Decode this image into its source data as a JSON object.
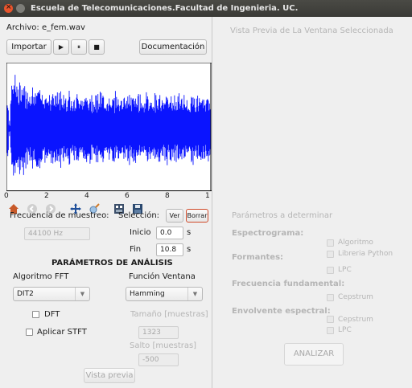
{
  "window": {
    "title": "Escuela de Telecomunicaciones.Facultad de Ingenieria. UC."
  },
  "file": {
    "label": "Archivo:",
    "name": "e_fem.wav"
  },
  "toolbar": {
    "import_label": "Importar",
    "play_icon": "▶",
    "pause_icon": "⏸",
    "stop_icon": "■",
    "docs_label": "Documentación"
  },
  "waveform": {
    "x_ticks": [
      "0",
      "2",
      "4",
      "6",
      "8",
      "1"
    ],
    "color": "#0a14ff"
  },
  "sample_rate": {
    "label": "Frecuencia de muestreo:",
    "placeholder": "44100 Hz"
  },
  "selection": {
    "label": "Selección:",
    "view_label": "Ver",
    "clear_label": "Borrar",
    "start_label": "Inicio",
    "start_value": "0.0",
    "end_label": "Fin",
    "end_value": "10.8",
    "unit": "s"
  },
  "analysis": {
    "heading": "PARÁMETROS DE ANÁLISIS",
    "fft_label": "Algoritmo FFT",
    "fft_value": "DIT2",
    "window_label": "Función Ventana",
    "window_value": "Hamming",
    "dft_label": "DFT",
    "stft_label": "Aplicar STFT",
    "size_label": "Tamaño [muestras]",
    "size_value": "1323",
    "hop_label": "Salto [muestras]",
    "hop_value": "-500",
    "preview_label": "Vista previa"
  },
  "preview": {
    "header": "Vista Previa de La Ventana Seleccionada"
  },
  "params": {
    "title": "Parámetros a determinar",
    "spectrogram": "Espectrograma:",
    "formants": "Formantes:",
    "algorithm": "Algoritmo",
    "python_lib": "Libreria Python",
    "lpc": "LPC",
    "fundamental": "Frecuencia fundamental:",
    "cepstrum": "Cepstrum",
    "envelope": "Envolvente espectral:",
    "envelope_cepstrum": "Cepstrum",
    "envelope_lpc": "LPC",
    "analyze_label": "ANALIZAR"
  }
}
